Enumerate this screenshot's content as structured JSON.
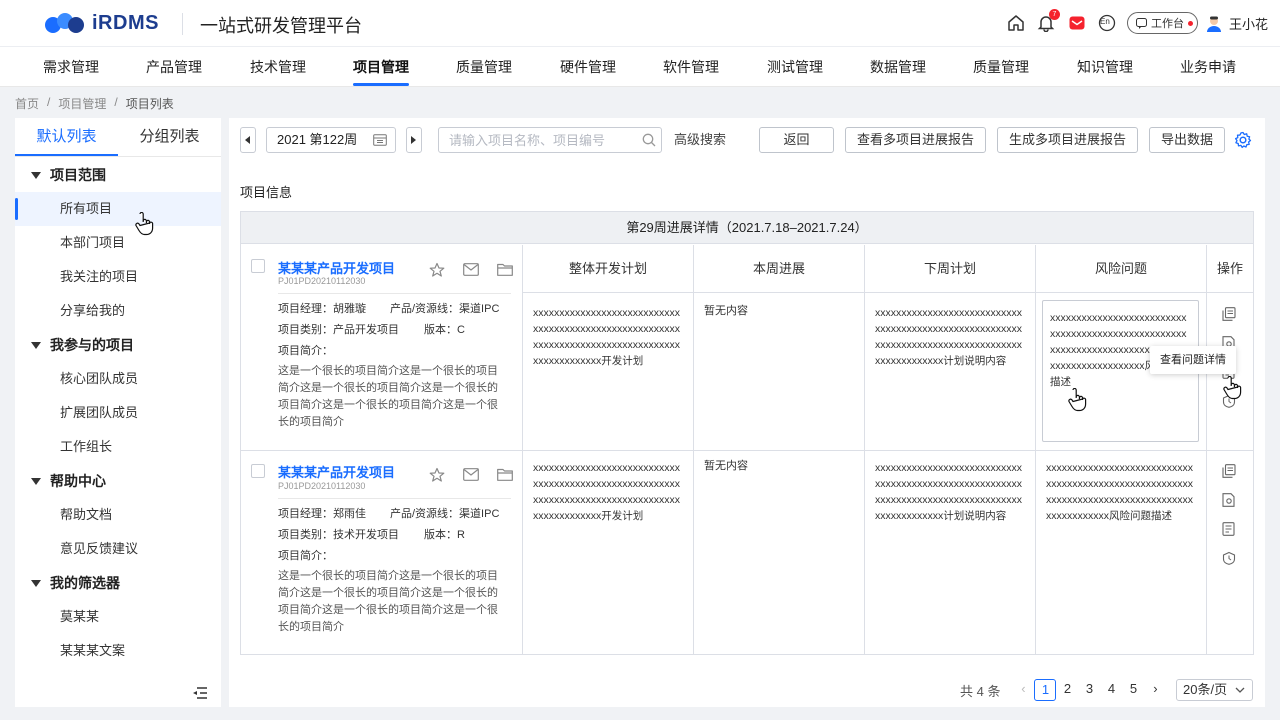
{
  "brand": {
    "name": "iRDMS",
    "platform": "一站式研发管理平台",
    "colors": {
      "accent": "#1a6dff",
      "logo": "#1d3d8f",
      "alert": "#f5222d"
    }
  },
  "header": {
    "notification_count": "7",
    "lang": "En",
    "workbench": "工作台",
    "user_name": "王小花",
    "icons": [
      "home-icon",
      "bell-icon",
      "mail-badge-icon",
      "lang-icon",
      "chat-icon",
      "user-avatar-icon"
    ]
  },
  "nav": [
    "需求管理",
    "产品管理",
    "技术管理",
    "项目管理",
    "质量管理",
    "硬件管理",
    "软件管理",
    "测试管理",
    "数据管理",
    "质量管理",
    "知识管理",
    "业务申请"
  ],
  "breadcrumb": [
    "首页",
    "项目管理",
    "项目列表"
  ],
  "sidebar": {
    "tabs": [
      "默认列表",
      "分组列表"
    ],
    "groups": [
      {
        "title": "项目范围",
        "items": [
          "所有项目",
          "本部门项目",
          "我关注的项目",
          "分享给我的"
        ]
      },
      {
        "title": "我参与的项目",
        "items": [
          "核心团队成员",
          "扩展团队成员",
          "工作组长"
        ]
      },
      {
        "title": "帮助中心",
        "items": [
          "帮助文档",
          "意见反馈建议"
        ]
      },
      {
        "title": "我的筛选器",
        "items": [
          "莫某某",
          "某某某文案"
        ]
      }
    ]
  },
  "toolbar": {
    "week": "2021 第122周",
    "search_placeholder": "请输入项目名称、项目编号",
    "advanced": "高级搜索",
    "back": "返回",
    "view_report": "查看多项目进展报告",
    "gen_report": "生成多项目进展报告",
    "export": "导出数据"
  },
  "section_title": "项目信息",
  "table": {
    "week_header": "第29周进展详情（2021.7.18–2021.7.24）",
    "columns": [
      "整体开发计划",
      "本周进展",
      "下周计划",
      "风险问题",
      "操作"
    ],
    "rows": [
      {
        "name": "某某某产品开发项目",
        "code": "PJ01PD20210112030",
        "manager": "项目经理：胡雅璇",
        "line": "产品/资源线：渠道IPC",
        "category": "项目类别：产品开发项目",
        "version": "版本：C",
        "intro_label": "项目简介：",
        "intro": "这是一个很长的项目简介这是一个很长的项目简介这是一个很长的项目简介这是一个很长的项目简介这是一个很长的项目简介这是一个很长的项目简介",
        "plan": "xxxxxxxxxxxxxxxxxxxxxxxxxxxxxxxxxxxxxxxxxxxxxxxxxxxxxxxxxxxxxxxxxxxxxxxxxxxxxxxxxxxxxxxxxxxxxxxxx开发计划",
        "progress": "暂无内容",
        "next": "xxxxxxxxxxxxxxxxxxxxxxxxxxxxxxxxxxxxxxxxxxxxxxxxxxxxxxxxxxxxxxxxxxxxxxxxxxxxxxxxxxxxxxxxxxxxxxxxx计划说明内容",
        "risk": "xxxxxxxxxxxxxxxxxxxxxxxxxxxxxxxxxxxxxxxxxxxxxxxxxxxxxxxxxxxxxxxxxxxxxxxxxxxxxxxxxxxxxxxxxxxxxxxx风险问题描述"
      },
      {
        "name": "某某某产品开发项目",
        "code": "PJ01PD20210112030",
        "manager": "项目经理：郑雨佳",
        "line": "产品/资源线：渠道IPC",
        "category": "项目类别：技术开发项目",
        "version": "版本：R",
        "intro_label": "项目简介：",
        "intro": "这是一个很长的项目简介这是一个很长的项目简介这是一个很长的项目简介这是一个很长的项目简介这是一个很长的项目简介这是一个很长的项目简介",
        "plan": "xxxxxxxxxxxxxxxxxxxxxxxxxxxxxxxxxxxxxxxxxxxxxxxxxxxxxxxxxxxxxxxxxxxxxxxxxxxxxxxxxxxxxxxxxxxxxxxxx开发计划",
        "progress": "暂无内容",
        "next": "xxxxxxxxxxxxxxxxxxxxxxxxxxxxxxxxxxxxxxxxxxxxxxxxxxxxxxxxxxxxxxxxxxxxxxxxxxxxxxxxxxxxxxxxxxxxxxxxx计划说明内容",
        "risk": "xxxxxxxxxxxxxxxxxxxxxxxxxxxxxxxxxxxxxxxxxxxxxxxxxxxxxxxxxxxxxxxxxxxxxxxxxxxxxxxxxxxxxxxxxxxxxxxx风险问题描述"
      }
    ],
    "tooltip": "查看问题详情"
  },
  "pagination": {
    "total": "共 4 条",
    "pages": [
      "1",
      "2",
      "3",
      "4",
      "5"
    ],
    "current": "1",
    "page_size": "20条/页"
  }
}
